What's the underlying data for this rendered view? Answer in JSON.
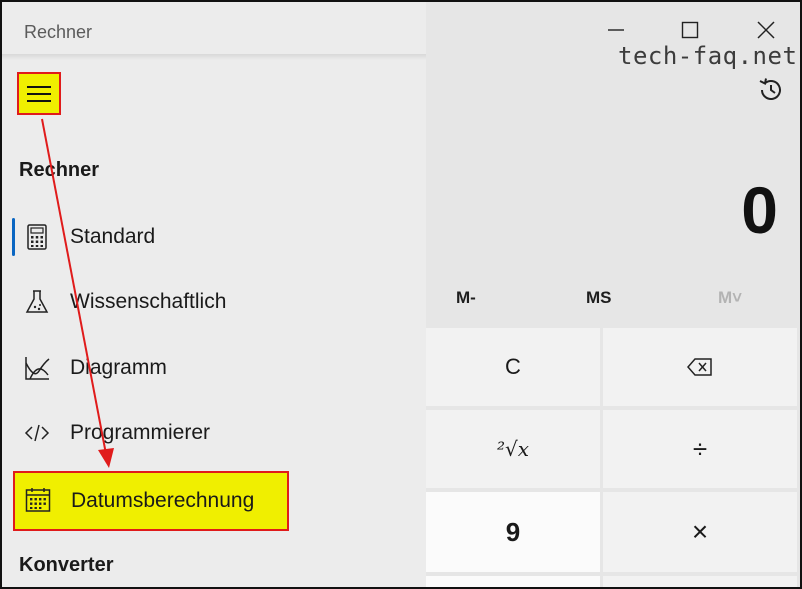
{
  "app": {
    "title": "Rechner"
  },
  "watermark": "tech-faq.net",
  "display": {
    "value": "0"
  },
  "memory": {
    "m_minus": "M-",
    "ms": "MS",
    "m_dropdown": "M˅"
  },
  "keys": {
    "clear": "C",
    "backspace_icon": "backspace-icon",
    "root": "²√x",
    "divide": "÷",
    "nine": "9",
    "multiply": "×"
  },
  "nav": {
    "section_calculator": "Rechner",
    "section_converter": "Konverter",
    "items": [
      {
        "label": "Standard",
        "icon": "calculator-icon",
        "active": true
      },
      {
        "label": "Wissenschaftlich",
        "icon": "flask-icon"
      },
      {
        "label": "Diagramm",
        "icon": "graph-icon"
      },
      {
        "label": "Programmierer",
        "icon": "code-icon"
      },
      {
        "label": "Datumsberechnung",
        "icon": "calendar-icon",
        "highlighted": true
      }
    ]
  },
  "colors": {
    "highlight": "#f0ef00",
    "annotation": "#e01b1b",
    "accent": "#0a66c2"
  }
}
